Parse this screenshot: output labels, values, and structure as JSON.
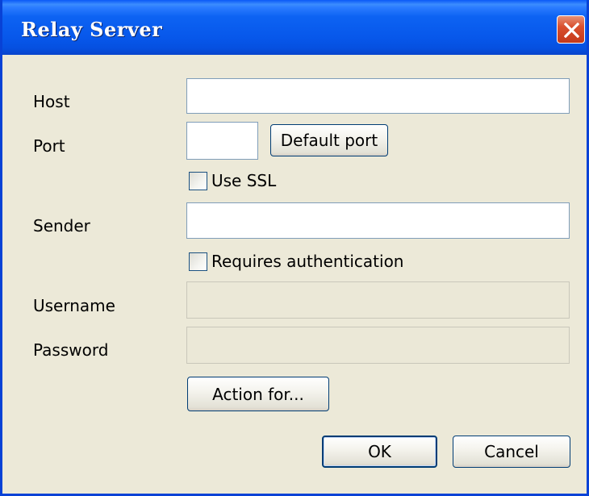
{
  "window": {
    "title": "Relay Server",
    "close_icon": "close-icon"
  },
  "form": {
    "host_label": "Host",
    "host_value": "",
    "port_label": "Port",
    "port_value": "",
    "default_port_label": "Default port",
    "use_ssl_label": "Use SSL",
    "use_ssl_checked": false,
    "sender_label": "Sender",
    "sender_value": "",
    "requires_auth_label": "Requires authentication",
    "requires_auth_checked": false,
    "username_label": "Username",
    "username_value": "",
    "password_label": "Password",
    "password_value": "",
    "action_for_label": "Action for..."
  },
  "footer": {
    "ok_label": "OK",
    "cancel_label": "Cancel"
  },
  "colors": {
    "titlebar": "#0757ea",
    "dialog_bg": "#ece9d8",
    "field_border": "#7f9db9",
    "close_button": "#d9502f"
  }
}
